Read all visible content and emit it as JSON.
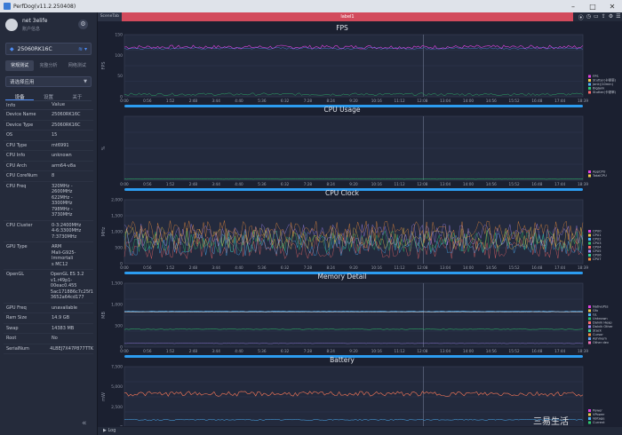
{
  "window": {
    "title": "PerfDog(v11.2.250408)"
  },
  "profile": {
    "name": "net 3elife",
    "sub": "账户信息"
  },
  "device": {
    "name": "25060RK16C"
  },
  "modes": [
    "常规测试",
    "完整分析",
    "网络测试"
  ],
  "app_select": {
    "placeholder": "请选择应用"
  },
  "subtabs": [
    "设备",
    "设置",
    "关于"
  ],
  "info_header": {
    "k": "Info",
    "v": "Value"
  },
  "info_rows": [
    {
      "k": "Device Name",
      "v": "25060RK16C"
    },
    {
      "k": "Device Type",
      "v": "25060RK16C"
    },
    {
      "k": "OS",
      "v": "15"
    },
    {
      "k": "CPU Type",
      "v": "mt6991"
    },
    {
      "k": "CPU Info",
      "v": "unknown"
    },
    {
      "k": "CPU Arch",
      "v": "arm64-v8a"
    },
    {
      "k": "CPU CoreNum",
      "v": "8"
    },
    {
      "k": "CPU Freq",
      "v": "320MHz - 2600MHz\n622MHz - 3300MHz\n798MHz - 3730MHz"
    },
    {
      "k": "CPU Cluster",
      "v": "0-3:2400MHz\n4-6:3300MHz\n7:3730MHz"
    },
    {
      "k": "GPU Type",
      "v": "ARM\nMali-G925-Immortali\ns MC12"
    },
    {
      "k": "OpenGL",
      "v": "OpenGL ES 3.2\nv1.r49p1-00eac0.455\n5ac171886c7c25f1\n3652a64cd177"
    },
    {
      "k": "GPU Freq",
      "v": "unavailable"
    },
    {
      "k": "Ram Size",
      "v": "14.9 GB"
    },
    {
      "k": "Swap",
      "v": "14383 MB"
    },
    {
      "k": "Root",
      "v": "No"
    },
    {
      "k": "SerialNum",
      "v": "4LBEJ7X47P877TTK"
    }
  ],
  "tabbar": {
    "scene": "SceneTab",
    "label": "label1"
  },
  "time_ticks": [
    "0:00",
    "0:56",
    "1:52",
    "2:48",
    "3:44",
    "4:40",
    "5:36",
    "6:32",
    "7:28",
    "8:24",
    "9:20",
    "10:16",
    "11:12",
    "12:08",
    "13:04",
    "14:00",
    "14:56",
    "15:52",
    "16:48",
    "17:44",
    "18:39"
  ],
  "panels": {
    "fps": {
      "title": "FPS",
      "ylabel": "FPS",
      "yticks": [
        "150",
        "100",
        "50",
        "0"
      ],
      "legend": [
        "FPS",
        "Stutter(卡顿率)",
        "Jank(/10min)",
        "BigJank",
        "Stutter(卡顿率)"
      ]
    },
    "cpu": {
      "title": "CPU Usage",
      "ylabel": "%",
      "yticks": [],
      "legend": [
        "AppCPU",
        "TotalCPU"
      ]
    },
    "clock": {
      "title": "CPU Clock",
      "ylabel": "MHz",
      "yticks": [
        "2,000",
        "1,500",
        "1,000",
        "500",
        "0"
      ],
      "legend": [
        "CPU0",
        "CPU1",
        "CPU2",
        "CPU3",
        "CPU4",
        "CPU5",
        "CPU6",
        "CPU7"
      ]
    },
    "memory": {
      "title": "Memory Detail",
      "ylabel": "MB",
      "yticks": [
        "1,500",
        "1,000",
        "500",
        "0"
      ],
      "legend": [
        "NativePss",
        "Gfx",
        "GL",
        "Unknown",
        "Dalvik Heap",
        "Dalvik Other",
        "Stack",
        "Cursor",
        "Ashmem",
        "Other dev"
      ]
    },
    "battery": {
      "title": "Battery",
      "ylabel": "mW",
      "yticks": [
        "7,500",
        "5,000",
        "2,500",
        "0"
      ],
      "legend": [
        "Power",
        "VPower",
        "Voltage",
        "Current"
      ]
    }
  },
  "colors": {
    "fps_line": "#e040e0",
    "accent": "#2c9cf0",
    "label_tab": "#d24a5c"
  },
  "log_label": "Log",
  "watermark": "三易生活"
}
